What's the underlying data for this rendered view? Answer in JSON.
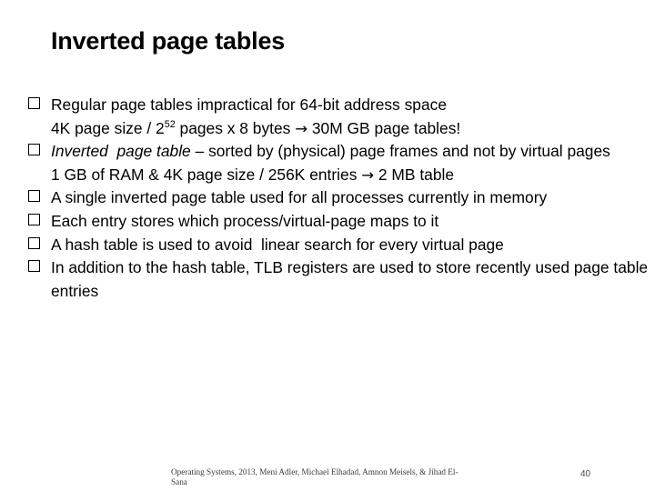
{
  "slide": {
    "title": "Inverted page tables",
    "page_number": "40",
    "background_color": "#ffffff",
    "text_color": "#000000",
    "bullet_glyph": "❑",
    "bullets": [
      {
        "id": "bullet-regular-page-tables",
        "line1": "Regular page tables impractical for 64-bit address space",
        "line2_pre": "4K page size / 2",
        "line2_sup": "52",
        "line2_post": " pages x 8 bytes ",
        "line2_arrow": "→",
        "line2_tail": " 30M GB page tables!"
      },
      {
        "id": "bullet-inverted-page-table",
        "italic_lead": "Inverted  page table",
        "rest": " – sorted by (physical) page frames and not by virtual pages",
        "sub_line_pre": "1 GB of RAM & 4K page size / 256K entries ",
        "sub_line_arrow": "→",
        "sub_line_post": " 2 MB table"
      },
      {
        "id": "bullet-single-inverted-table",
        "text": "A single inverted page table used for all processes currently in memory"
      },
      {
        "id": "bullet-each-entry",
        "text": "Each entry stores which process/virtual-page maps to it"
      },
      {
        "id": "bullet-hash-table",
        "text": "A hash table is used to avoid  linear search for every virtual page"
      },
      {
        "id": "bullet-tlb-registers",
        "text": "In addition to the hash table, TLB registers are used to store recently used page table entries"
      }
    ],
    "footer": {
      "line1": "Operating Systems, 2013, Meni Adler, Michael Elhadad, Amnon Meisels, & Jihad El-",
      "line2": "Sana"
    }
  }
}
